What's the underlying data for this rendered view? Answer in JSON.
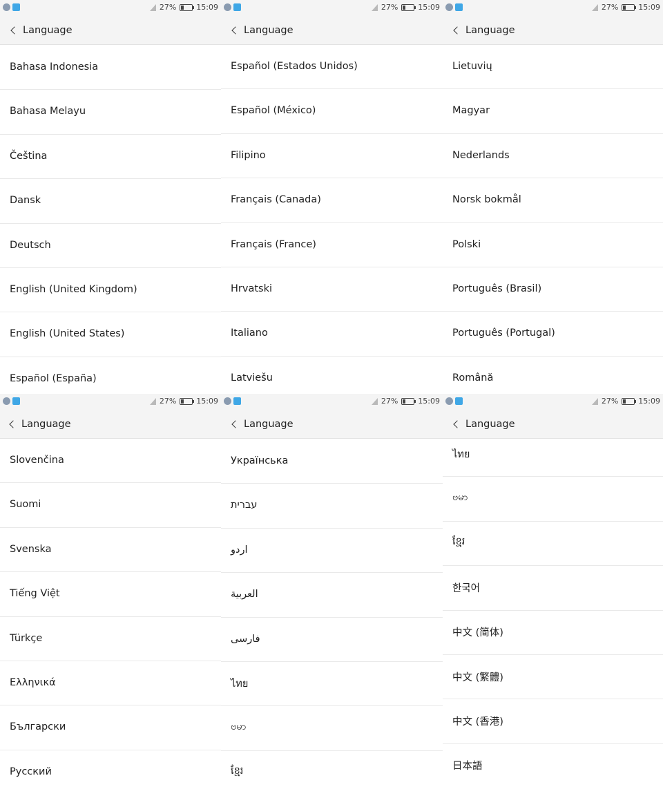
{
  "panels": [
    {
      "status": {
        "battery_percent_text": "27%",
        "battery_level": 0.27,
        "time": "15:09"
      },
      "header": {
        "title": "Language"
      },
      "items": [
        "Bahasa Indonesia",
        "Bahasa Melayu",
        "Čeština",
        "Dansk",
        "Deutsch",
        "English (United Kingdom)",
        "English (United States)",
        "Español (España)"
      ]
    },
    {
      "status": {
        "battery_percent_text": "27%",
        "battery_level": 0.27,
        "time": "15:09"
      },
      "header": {
        "title": "Language"
      },
      "items": [
        "Español (Estados Unidos)",
        "Español (México)",
        "Filipino",
        "Français (Canada)",
        "Français (France)",
        "Hrvatski",
        "Italiano",
        "Latviešu"
      ]
    },
    {
      "status": {
        "battery_percent_text": "27%",
        "battery_level": 0.27,
        "time": "15:09"
      },
      "header": {
        "title": "Language"
      },
      "items": [
        "Lietuvių",
        "Magyar",
        "Nederlands",
        "Norsk bokmål",
        "Polski",
        "Português (Brasil)",
        "Português (Portugal)",
        "Română"
      ]
    },
    {
      "status": {
        "battery_percent_text": "27%",
        "battery_level": 0.27,
        "time": "15:09"
      },
      "header": {
        "title": "Language"
      },
      "items": [
        "Slovenčina",
        "Suomi",
        "Svenska",
        "Tiếng Việt",
        "Türkçe",
        "Ελληνικά",
        "Български",
        "Русский"
      ]
    },
    {
      "status": {
        "battery_percent_text": "27%",
        "battery_level": 0.27,
        "time": "15:09"
      },
      "header": {
        "title": "Language"
      },
      "items": [
        "Українська",
        "עברית",
        "اردو",
        "العربية",
        "فارسی",
        "ไทย",
        "ဗမာ",
        "ខ្មែរ"
      ]
    },
    {
      "status": {
        "battery_percent_text": "27%",
        "battery_level": 0.27,
        "time": "15:09"
      },
      "header": {
        "title": "Language"
      },
      "items": [
        "ไทย",
        "ဗမာ",
        "ខ្មែរ",
        "한국어",
        "中文 (简体)",
        "中文 (繁體)",
        "中文 (香港)",
        "日本語"
      ]
    }
  ],
  "colors": {
    "statusbar_bg": "#f4f4f4",
    "appbar_bg": "#f4f4f4",
    "divider": "#e9e9e9",
    "text": "#222222"
  },
  "icons": {
    "back": "chevron-left-icon",
    "signal": "signal-icon",
    "battery": "battery-icon",
    "notification_a": "notification-icon",
    "notification_b": "app-notification-icon"
  }
}
